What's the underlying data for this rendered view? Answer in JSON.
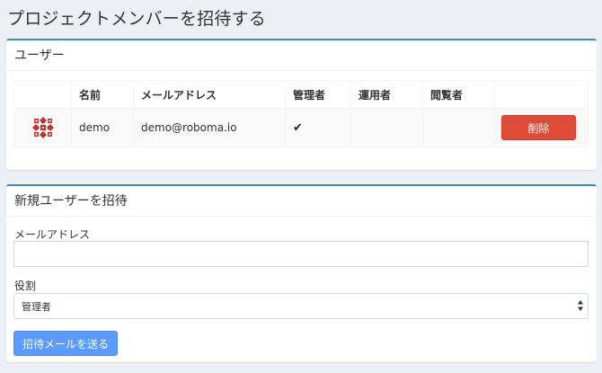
{
  "page": {
    "title": "プロジェクトメンバーを招待する"
  },
  "users_box": {
    "title": "ユーザー",
    "columns": [
      "",
      "名前",
      "メールアドレス",
      "管理者",
      "運用者",
      "閲覧者",
      ""
    ],
    "rows": [
      {
        "name": "demo",
        "email": "demo@roboma.io",
        "admin": "✔",
        "operator": "",
        "viewer": "",
        "delete_label": "削除",
        "avatar_icon": "identicon-avatar",
        "avatar_color": "#c9302c"
      }
    ]
  },
  "invite_box": {
    "title": "新規ユーザーを招待",
    "email_label": "メールアドレス",
    "email_value": "",
    "email_placeholder": "",
    "role_label": "役割",
    "role_selected": "管理者",
    "submit_label": "招待メールを送る"
  },
  "colors": {
    "background": "#ecf0f5",
    "box_accent": "#3c8dbc",
    "danger": "#dd4b39",
    "primary": "#5b9bff"
  }
}
